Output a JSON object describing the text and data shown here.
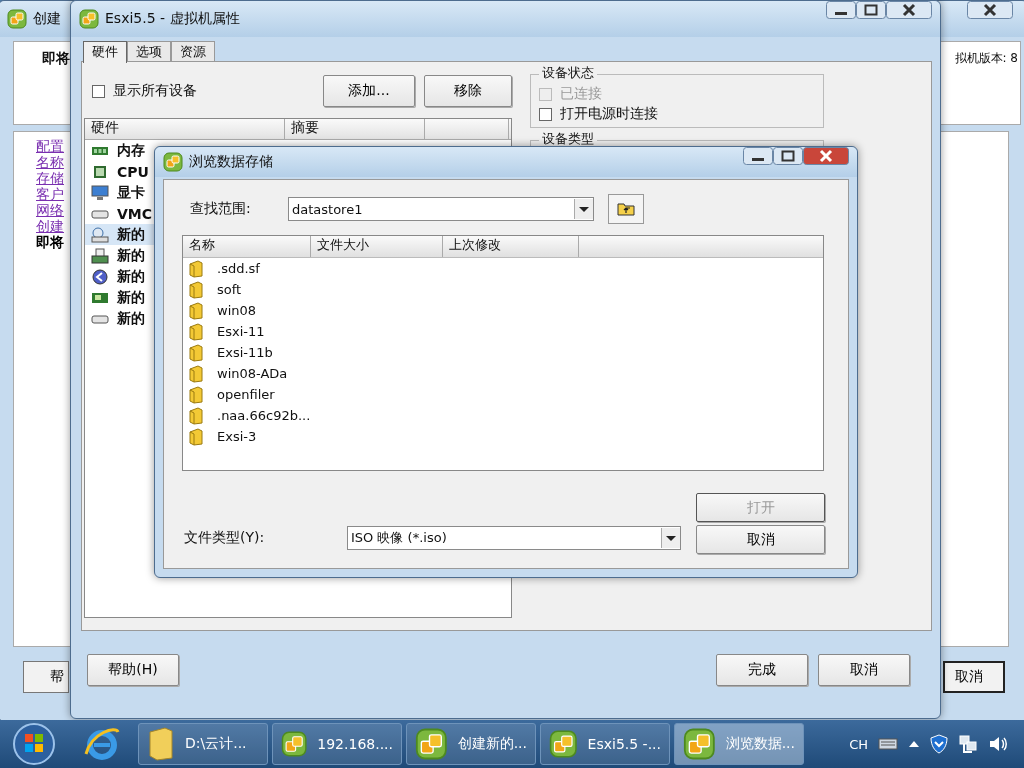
{
  "back_window": {
    "title": "创建",
    "heading": "即将",
    "version_label": "拟机版本: 8",
    "steps": [
      {
        "label": "配置",
        "selected": false
      },
      {
        "label": "名称",
        "selected": false
      },
      {
        "label": "存储",
        "selected": false
      },
      {
        "label": "客户",
        "selected": false
      },
      {
        "label": "网络",
        "selected": false
      },
      {
        "label": "创建",
        "selected": false
      },
      {
        "label": "即将",
        "selected": true
      }
    ],
    "buttons": [
      "帮",
      "取消"
    ]
  },
  "properties_window": {
    "title": "Esxi5.5 - 虚拟机属性",
    "tabs": [
      {
        "label": "硬件",
        "selected": true
      },
      {
        "label": "选项",
        "selected": false
      },
      {
        "label": "资源",
        "selected": false
      }
    ],
    "show_all_devices": {
      "label": "显示所有设备",
      "checked": false
    },
    "buttons": [
      "添加...",
      "移除"
    ],
    "columns": [
      "硬件",
      "摘要"
    ],
    "hardware": [
      {
        "label": "内存",
        "kind": "memory",
        "selected": false
      },
      {
        "label": "CPU",
        "kind": "cpu",
        "selected": false
      },
      {
        "label": "显卡",
        "kind": "display",
        "selected": false
      },
      {
        "label": "VMC",
        "kind": "device",
        "selected": false
      },
      {
        "label": "新的",
        "kind": "cdrom",
        "selected": true
      },
      {
        "label": "新的",
        "kind": "floppy",
        "selected": false
      },
      {
        "label": "新的",
        "kind": "serial",
        "selected": false
      },
      {
        "label": "新的",
        "kind": "network",
        "selected": false
      },
      {
        "label": "新的",
        "kind": "device",
        "selected": false
      }
    ],
    "device_status": {
      "title": "设备状态",
      "options": [
        {
          "label": "已连接",
          "checked": false,
          "disabled": true
        },
        {
          "label": "打开电源时连接",
          "checked": false,
          "disabled": false
        }
      ]
    },
    "device_type": {
      "title": "设备类型"
    },
    "help_button": "帮助(H)",
    "footer_buttons": [
      "完成",
      "取消"
    ]
  },
  "browse_dialog": {
    "title": "浏览数据存储",
    "look_in_label": "查找范围:",
    "look_in_value": "datastore1",
    "columns": [
      "名称",
      "文件大小",
      "上次修改"
    ],
    "files": [
      {
        "name": ".sdd.sf"
      },
      {
        "name": "soft"
      },
      {
        "name": "win08"
      },
      {
        "name": "Esxi-11"
      },
      {
        "name": "Exsi-11b"
      },
      {
        "name": "win08-ADa"
      },
      {
        "name": "openfiler"
      },
      {
        "name": ".naa.66c92b..."
      },
      {
        "name": "Exsi-3"
      }
    ],
    "file_type_label": "文件类型(Y):",
    "file_type_value": "ISO 映像 (*.iso)",
    "open_button": {
      "label": "打开",
      "disabled": true
    },
    "cancel_button": "取消"
  },
  "taskbar": {
    "items": [
      {
        "label": "D:\\云计...",
        "kind": "folder",
        "selected": false
      },
      {
        "label": "192.168....",
        "kind": "vsphere",
        "selected": false
      },
      {
        "label": "创建新的...",
        "kind": "vsphere",
        "selected": false
      },
      {
        "label": "Esxi5.5 -...",
        "kind": "vsphere",
        "selected": false
      },
      {
        "label": "浏览数据...",
        "kind": "vsphere",
        "selected": true
      }
    ],
    "language": "CH"
  }
}
